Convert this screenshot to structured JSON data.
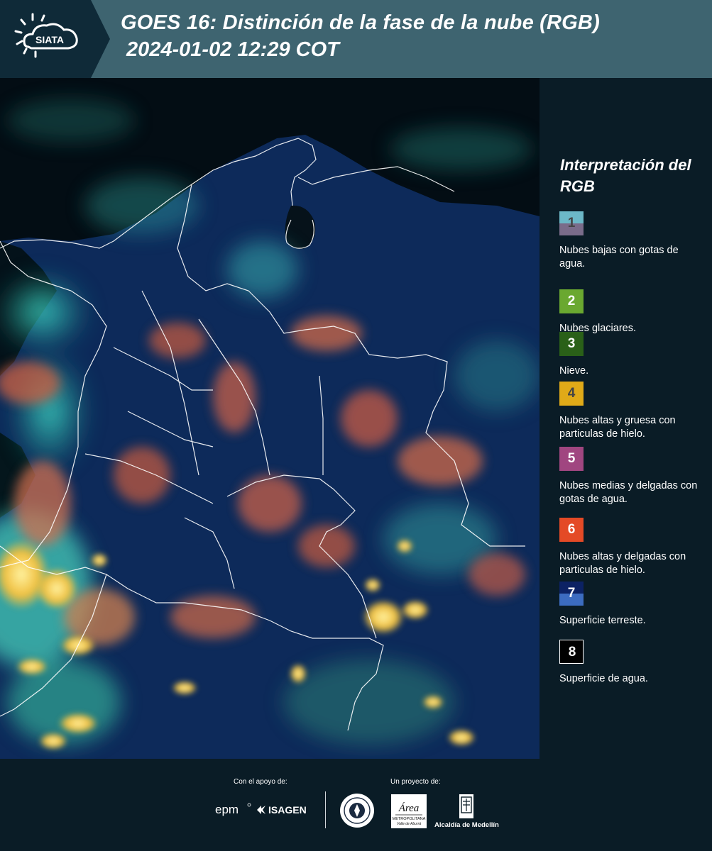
{
  "header": {
    "logo_text": "SIATA",
    "title_line1": "GOES 16: Distinción de la fase de la nube (RGB)",
    "title_line2": "2024-01-02 12:29 COT"
  },
  "legend": {
    "title": "Interpretación del RGB",
    "items": [
      {
        "number": "1",
        "label": "Nubes bajas con gotas de agua.",
        "color_top": "#6cb8c8",
        "color_bottom": "#7a6c8a",
        "num_color": "#444444"
      },
      {
        "number": "2",
        "label": "Nubes glaciares.",
        "color_top": "#6aa830",
        "color_bottom": "#6aa830",
        "num_color": "#ffffff"
      },
      {
        "number": "3",
        "label": "Nieve.",
        "color_top": "#2a6018",
        "color_bottom": "#2a6018",
        "num_color": "#ffffff"
      },
      {
        "number": "4",
        "label": "Nubes altas y gruesa con particulas de hielo.",
        "color_top": "#e0aa18",
        "color_bottom": "#e0aa18",
        "num_color": "#444444"
      },
      {
        "number": "5",
        "label": "Nubes medias y delgadas con gotas de agua.",
        "color_top": "#a04680",
        "color_bottom": "#a04680",
        "num_color": "#ffffff"
      },
      {
        "number": "6",
        "label": "Nubes altas y delgadas con particulas de hielo.",
        "color_top": "#e44a26",
        "color_bottom": "#e44a26",
        "num_color": "#ffffff"
      },
      {
        "number": "7",
        "label": "Superficie terreste.",
        "color_top": "#0c2264",
        "color_bottom": "#3c6cc0",
        "num_color": "#ffffff"
      },
      {
        "number": "8",
        "label": "Superficie de agua.",
        "color_top": "#000000",
        "color_bottom": "#000000",
        "num_color": "#ffffff"
      }
    ]
  },
  "footer": {
    "support_label": "Con el apoyo de:",
    "project_label": "Un proyecto de:",
    "sponsors": [
      "epm",
      "ISAGEN"
    ],
    "partners": [
      "Área Metropolitana",
      "Alcaldía de Medellín"
    ],
    "area_logo_text": "Área",
    "area_logo_subtext": "METROPOLITANA",
    "area_logo_subtext2": "Valle de Aburrá",
    "alcaldia_label": "Alcaldía de Medellín"
  }
}
